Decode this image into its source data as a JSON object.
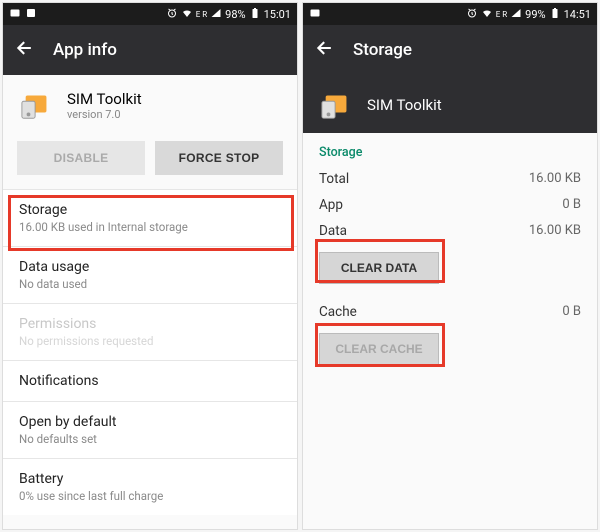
{
  "left": {
    "status": {
      "battery": "98%",
      "time": "15:01",
      "net": "E R"
    },
    "appbar_title": "App info",
    "app_name": "SIM Toolkit",
    "app_version": "version 7.0",
    "btn_disable": "DISABLE",
    "btn_force_stop": "FORCE STOP",
    "items": [
      {
        "primary": "Storage",
        "secondary": "16.00 KB used in Internal storage"
      },
      {
        "primary": "Data usage",
        "secondary": "No data used"
      },
      {
        "primary": "Permissions",
        "secondary": "No permissions requested"
      },
      {
        "primary": "Notifications",
        "secondary": ""
      },
      {
        "primary": "Open by default",
        "secondary": "No defaults set"
      },
      {
        "primary": "Battery",
        "secondary": "0% use since last full charge"
      }
    ]
  },
  "right": {
    "status": {
      "battery": "99%",
      "time": "14:51",
      "net": "E R"
    },
    "appbar_title": "Storage",
    "app_name": "SIM Toolkit",
    "section_label": "Storage",
    "rows": [
      {
        "label": "Total",
        "value": "16.00 KB"
      },
      {
        "label": "App",
        "value": "0 B"
      },
      {
        "label": "Data",
        "value": "16.00 KB"
      }
    ],
    "btn_clear_data": "CLEAR DATA",
    "cache_label": "Cache",
    "cache_value": "0 B",
    "btn_clear_cache": "CLEAR CACHE"
  }
}
